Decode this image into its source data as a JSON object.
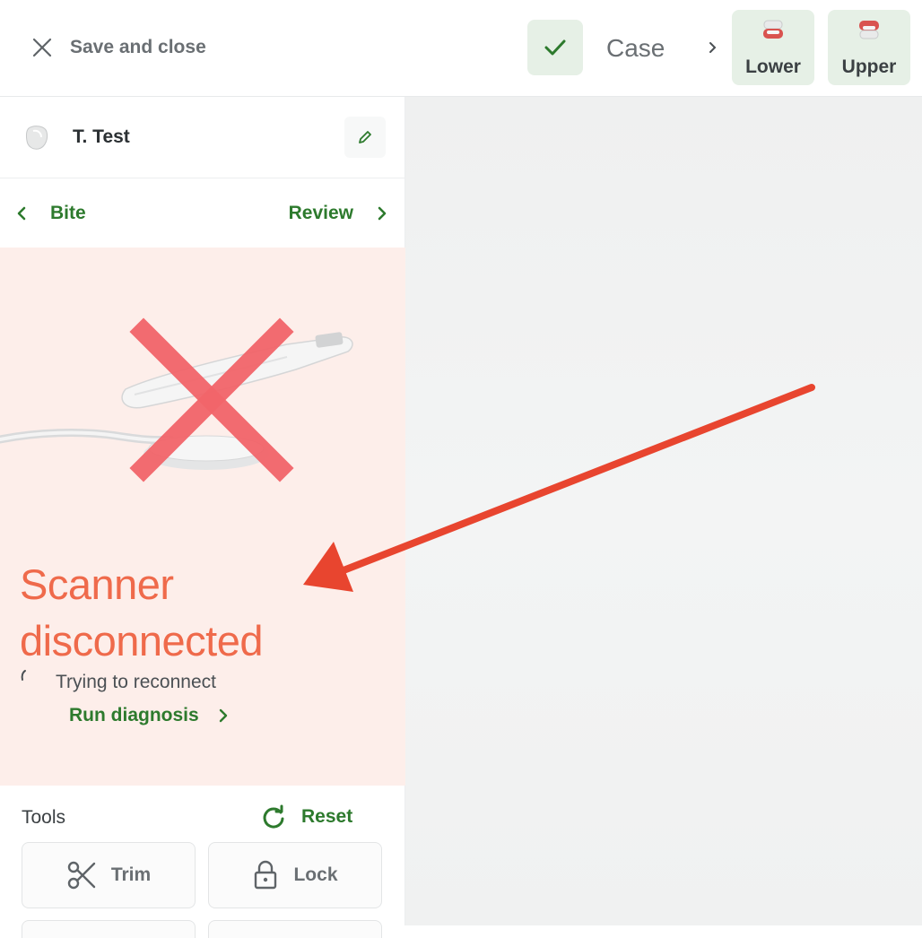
{
  "header": {
    "save_close_label": "Save and close",
    "case_label": "Case",
    "jaw_buttons": [
      {
        "label": "Lower"
      },
      {
        "label": "Upper"
      }
    ]
  },
  "patient": {
    "name": "T. Test"
  },
  "navigation": {
    "back_label": "Bite",
    "next_label": "Review"
  },
  "scanner_status": {
    "title_line1": "Scanner",
    "title_line2": "disconnected",
    "status_text": "Trying to reconnect",
    "diagnosis_label": "Run diagnosis"
  },
  "tools": {
    "heading": "Tools",
    "reset_label": "Reset",
    "items": [
      {
        "label": "Trim",
        "icon": "scissors-icon"
      },
      {
        "label": "Lock",
        "icon": "lock-icon"
      }
    ]
  },
  "colors": {
    "accent_green": "#2d7a2d",
    "error_red": "#ef6a4b",
    "error_bg": "#fdeeea",
    "annotation_arrow": "#e8452f"
  }
}
